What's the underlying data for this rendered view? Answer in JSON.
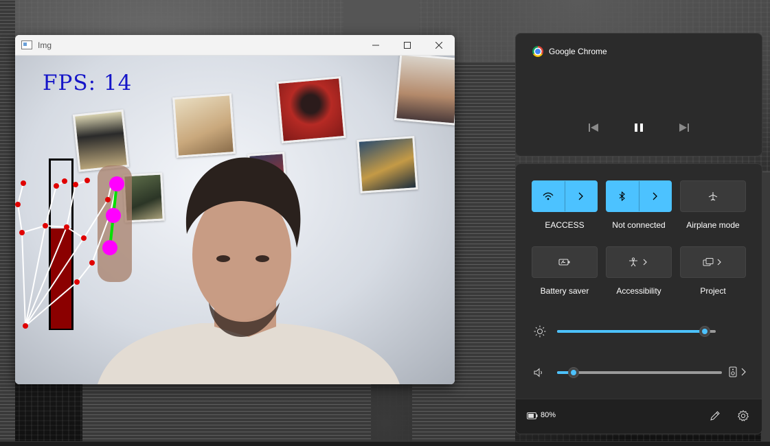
{
  "cv_window": {
    "title": "Img",
    "fps_label": "FPS: 14",
    "volume_level": 0.6
  },
  "media": {
    "app_name": "Google Chrome",
    "controls": [
      "previous-icon",
      "pause-icon",
      "next-icon"
    ]
  },
  "quick_settings": {
    "tiles": [
      {
        "label": "EACCESS",
        "icon": "wifi-icon",
        "state": "on"
      },
      {
        "label": "Not connected",
        "icon": "bluetooth-icon",
        "state": "on"
      },
      {
        "label": "Airplane mode",
        "icon": "airplane-icon",
        "state": "off"
      },
      {
        "label": "Battery saver",
        "icon": "battery-saver-icon",
        "state": "off"
      },
      {
        "label": "Accessibility",
        "icon": "accessibility-icon",
        "state": "off"
      },
      {
        "label": "Project",
        "icon": "project-icon",
        "state": "off"
      }
    ],
    "brightness": 0.93,
    "volume": 0.1,
    "battery": "80%"
  },
  "colors": {
    "accent": "#4cc2ff",
    "panel": "#2b2b2b",
    "fps_text": "#1515c8",
    "volume_bar": "#8b0000",
    "landmark_line": "#00e000",
    "landmark_point": "#ff00ff"
  }
}
